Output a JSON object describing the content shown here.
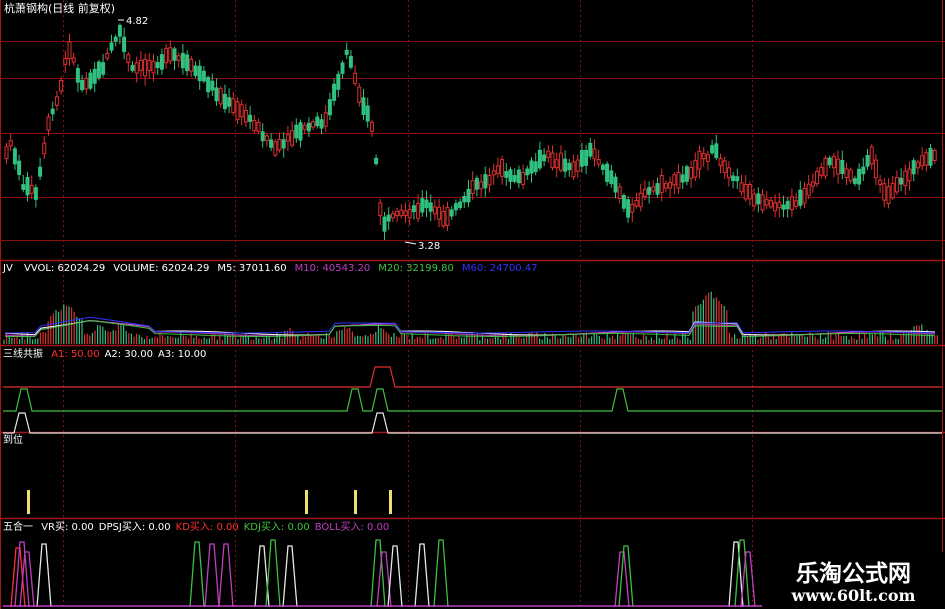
{
  "title": "杭萧钢构(日线 前复权)",
  "price_panel": {
    "high_label": "4.82",
    "low_label": "3.28"
  },
  "volume_panel": {
    "prefix": "JV",
    "items": [
      {
        "text": "VVOL: 62024.29",
        "color": "#ffffff"
      },
      {
        "text": "VOLUME: 62024.29",
        "color": "#ffffff"
      },
      {
        "text": "M5: 37011.60",
        "color": "#ffffff"
      },
      {
        "text": "M10: 40543.20",
        "color": "#c040c0"
      },
      {
        "text": "M20: 32199.80",
        "color": "#40c040"
      },
      {
        "text": "M60: 24700.47",
        "color": "#3030ff"
      }
    ]
  },
  "sanxian_panel": {
    "name": "三线共振",
    "items": [
      {
        "text": "A1: 50.00",
        "color": "#ff3030"
      },
      {
        "text": "A2: 30.00",
        "color": "#ffffff"
      },
      {
        "text": "A3: 10.00",
        "color": "#ffffff"
      }
    ]
  },
  "daowei_panel": {
    "name": "到位"
  },
  "wuheyi_panel": {
    "name": "五合一",
    "items": [
      {
        "text": "VR买: 0.00",
        "color": "#ffffff"
      },
      {
        "text": "DPSJ买入: 0.00",
        "color": "#ffffff"
      },
      {
        "text": "KD买入: 0.00",
        "color": "#ff3030"
      },
      {
        "text": "KDJ买入: 0.00",
        "color": "#40c040"
      },
      {
        "text": "BOLL买入: 0.00",
        "color": "#c040c0"
      }
    ]
  },
  "watermark": {
    "cn": "乐淘公式网",
    "url": "www.60lt.com"
  },
  "colors": {
    "up": "#e03030",
    "down": "#30c080",
    "grid": "#8a1010",
    "separator": "#a01818"
  }
}
